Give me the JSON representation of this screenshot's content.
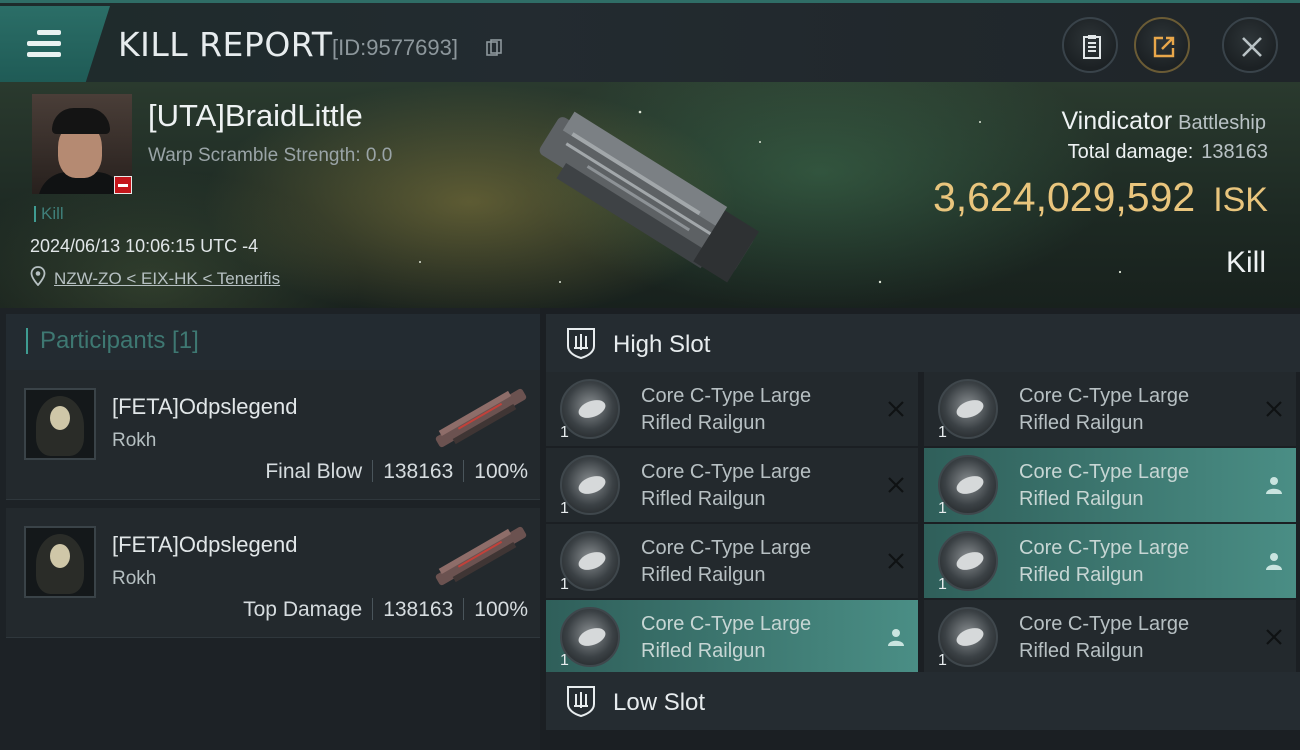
{
  "header": {
    "title": "KILL REPORT",
    "id_label": "[ID:9577693]"
  },
  "victim": {
    "name": "[UTA]BraidLittle",
    "warp_scramble": "Warp Scramble Strength: 0.0",
    "tag": "Kill",
    "datetime": "2024/06/13 10:06:15 UTC -4",
    "location": "NZW-ZO < EIX-HK < Tenerifis",
    "ship": "Vindicator",
    "ship_class": "Battleship",
    "total_damage_label": "Total damage:",
    "total_damage": "138163",
    "isk_value": "3,624,029,592",
    "isk_unit": "ISK",
    "result": "Kill"
  },
  "participants": {
    "header": "Participants [1]",
    "rows": [
      {
        "name": "[FETA]Odpslegend",
        "ship": "Rokh",
        "role": "Final Blow",
        "damage": "138163",
        "percent": "100%"
      },
      {
        "name": "[FETA]Odpslegend",
        "ship": "Rokh",
        "role": "Top Damage",
        "damage": "138163",
        "percent": "100%"
      }
    ]
  },
  "slots": {
    "high_label": "High Slot",
    "low_label": "Low Slot",
    "items": [
      {
        "line1": "Core C-Type Large",
        "line2": "Rifled Railgun",
        "qty": "1",
        "status": "destroyed"
      },
      {
        "line1": "Core C-Type Large",
        "line2": "Rifled Railgun",
        "qty": "1",
        "status": "destroyed"
      },
      {
        "line1": "Core C-Type Large",
        "line2": "Rifled Railgun",
        "qty": "1",
        "status": "destroyed"
      },
      {
        "line1": "Core C-Type Large",
        "line2": "Rifled Railgun",
        "qty": "1",
        "status": "dropped"
      },
      {
        "line1": "Core C-Type Large",
        "line2": "Rifled Railgun",
        "qty": "1",
        "status": "destroyed"
      },
      {
        "line1": "Core C-Type Large",
        "line2": "Rifled Railgun",
        "qty": "1",
        "status": "dropped"
      },
      {
        "line1": "Core C-Type Large",
        "line2": "Rifled Railgun",
        "qty": "1",
        "status": "dropped"
      },
      {
        "line1": "Core C-Type Large",
        "line2": "Rifled Railgun",
        "qty": "1",
        "status": "destroyed"
      }
    ]
  },
  "colors": {
    "accent_teal": "#3f9c92",
    "isk_gold": "#e9c57d",
    "dropped_bg": "#4a8e85",
    "victim_badge_red": "#c4161c"
  },
  "icons": [
    "menu-icon",
    "copy-icon",
    "clipboard-icon",
    "share-icon",
    "close-icon",
    "location-pin-icon",
    "shield-slot-icon",
    "destroyed-x-icon",
    "dropped-person-icon"
  ]
}
